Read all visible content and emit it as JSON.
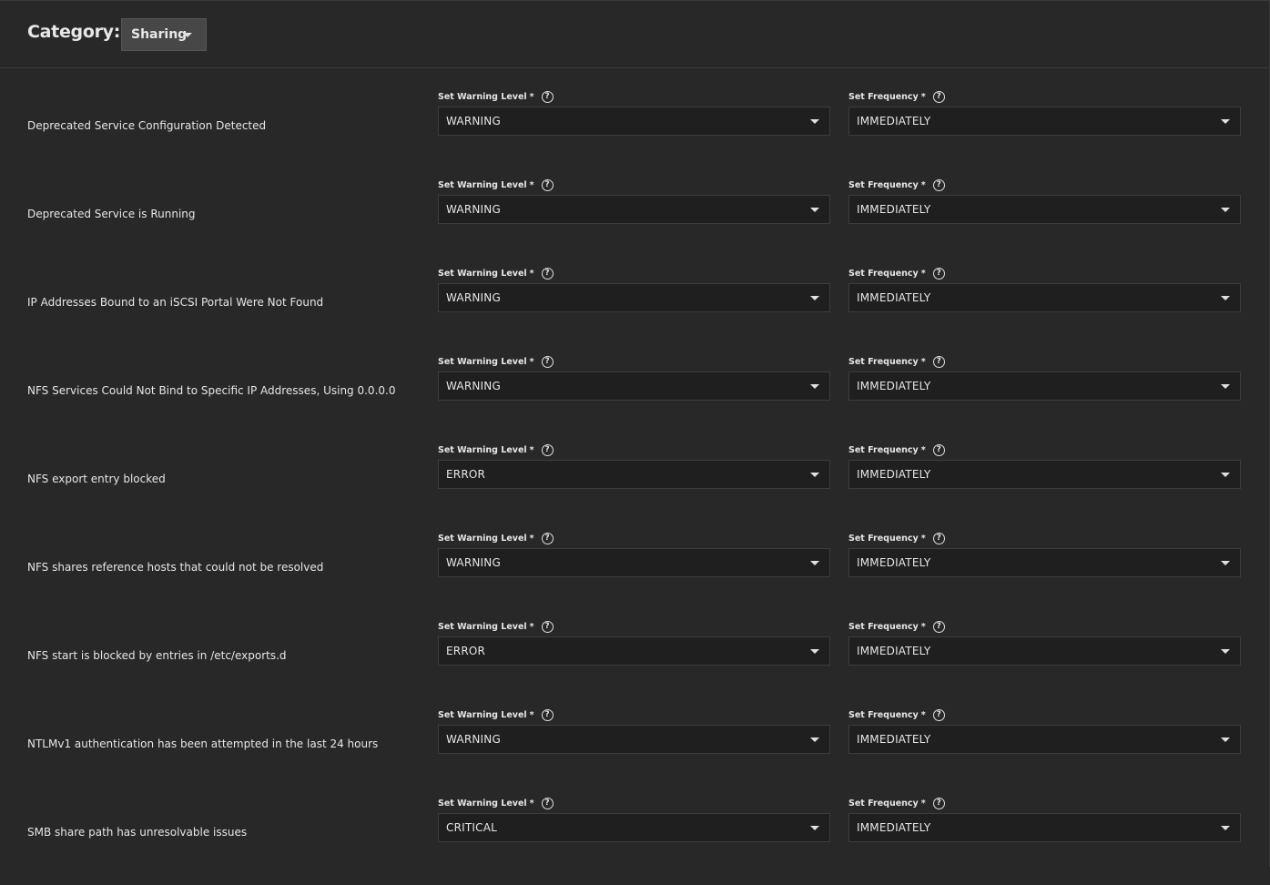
{
  "header": {
    "category_label": "Category:",
    "category_value": "Sharing"
  },
  "field_labels": {
    "level": "Set Warning Level",
    "frequency": "Set Frequency",
    "required_mark": "*",
    "help_glyph": "?"
  },
  "alerts": [
    {
      "label": "Deprecated Service Configuration Detected",
      "level": "WARNING",
      "frequency": "IMMEDIATELY"
    },
    {
      "label": "Deprecated Service is Running",
      "level": "WARNING",
      "frequency": "IMMEDIATELY"
    },
    {
      "label": "IP Addresses Bound to an iSCSI Portal Were Not Found",
      "level": "WARNING",
      "frequency": "IMMEDIATELY"
    },
    {
      "label": "NFS Services Could Not Bind to Specific IP Addresses, Using 0.0.0.0",
      "level": "WARNING",
      "frequency": "IMMEDIATELY"
    },
    {
      "label": "NFS export entry blocked",
      "level": "ERROR",
      "frequency": "IMMEDIATELY"
    },
    {
      "label": "NFS shares reference hosts that could not be resolved",
      "level": "WARNING",
      "frequency": "IMMEDIATELY"
    },
    {
      "label": "NFS start is blocked by entries in /etc/exports.d",
      "level": "ERROR",
      "frequency": "IMMEDIATELY"
    },
    {
      "label": "NTLMv1 authentication has been attempted in the last 24 hours",
      "level": "WARNING",
      "frequency": "IMMEDIATELY"
    },
    {
      "label": "SMB share path has unresolvable issues",
      "level": "CRITICAL",
      "frequency": "IMMEDIATELY"
    }
  ]
}
